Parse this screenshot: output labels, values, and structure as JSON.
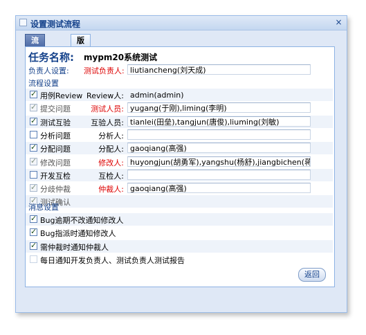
{
  "window": {
    "title": "设置测试流程",
    "close": "×"
  },
  "tabs": [
    {
      "label": "流程设置",
      "active": true
    },
    {
      "label": "版本维护",
      "active": false
    }
  ],
  "task": {
    "label": "任务名称:",
    "value": "mypm20系统测试"
  },
  "owner": {
    "label": "负责人设置:",
    "role": "测试负责人:",
    "value": "liutiancheng(刘天成)"
  },
  "flow_section": "流程设置",
  "flow": [
    {
      "step": "用例Review",
      "checked": true,
      "disabled": false,
      "role": "Review人:",
      "red": false,
      "value": "admin(admin)"
    },
    {
      "step": "提交问题",
      "checked": true,
      "disabled": true,
      "role": "测试人员:",
      "red": true,
      "value": "yugang(于刚),liming(李明)"
    },
    {
      "step": "测试互验",
      "checked": true,
      "disabled": false,
      "role": "互验人员:",
      "red": false,
      "value": "tianlei(田垒),tangjun(唐俊),liuming(刘敏)"
    },
    {
      "step": "分析问题",
      "checked": false,
      "disabled": false,
      "role": "分析人:",
      "red": false,
      "value": ""
    },
    {
      "step": "分配问题",
      "checked": true,
      "disabled": false,
      "role": "分配人:",
      "red": false,
      "value": "gaoqiang(高强)"
    },
    {
      "step": "修改问题",
      "checked": true,
      "disabled": true,
      "role": "修改人:",
      "red": true,
      "value": "huyongjun(胡勇军),yangshu(杨舒),jiangbichen(蒋必成)"
    },
    {
      "step": "开发互检",
      "checked": false,
      "disabled": false,
      "role": "互检人:",
      "red": false,
      "value": ""
    },
    {
      "step": "分歧仲裁",
      "checked": true,
      "disabled": true,
      "role": "仲裁人:",
      "red": true,
      "value": "gaoqiang(高强)"
    },
    {
      "step": "测试确认",
      "checked": true,
      "disabled": true,
      "role": "",
      "red": false,
      "value": ""
    }
  ],
  "message_section": "消息设置",
  "messages": [
    {
      "label": "Bug逾期不改通知修改人",
      "checked": true
    },
    {
      "label": "Bug指派时通知修改人",
      "checked": true
    },
    {
      "label": "需仲裁时通知仲裁人",
      "checked": true
    },
    {
      "label": "每日通知开发负责人、测试负责人测试报告",
      "checked": false
    }
  ],
  "buttons": {
    "back": "返回"
  }
}
